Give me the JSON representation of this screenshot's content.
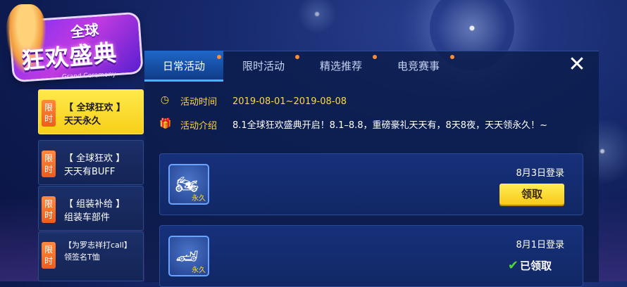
{
  "logo": {
    "line1": "全球",
    "line2": "狂欢盛典",
    "subtitle": "Grand Ceremony"
  },
  "sidebar": {
    "items": [
      {
        "badge": [
          "限",
          "时"
        ],
        "line1": "【 全球狂欢 】",
        "line2": "天天永久",
        "active": true
      },
      {
        "badge": [
          "限",
          "时"
        ],
        "line1": "【 全球狂欢 】",
        "line2": "天天有BUFF",
        "active": false
      },
      {
        "badge": [
          "限",
          "时"
        ],
        "line1": "【 组装补给 】",
        "line2": "组装车部件",
        "active": false
      },
      {
        "badge": [
          "限",
          "时"
        ],
        "line1": "【为罗志祥打call】",
        "line2": "领签名T恤",
        "active": false
      }
    ]
  },
  "tabs": [
    {
      "label": "日常活动",
      "active": true
    },
    {
      "label": "限时活动",
      "active": false
    },
    {
      "label": "精选推荐",
      "active": false
    },
    {
      "label": "电竞赛事",
      "active": false
    }
  ],
  "close_icon": "close-icon",
  "activity": {
    "time_label": "活动时间",
    "time_value": "2019-08-01~2019-08-08",
    "intro_label": "活动介绍",
    "intro_value": "8.1全球狂欢盛典开启！8.1–8.8，重磅豪礼天天有，8天8夜，天天领永久！~"
  },
  "rewards": [
    {
      "icon": "motorcycle-icon",
      "tag": "永久",
      "login_text": "8月3日登录",
      "action_label": "领取",
      "claimed": false
    },
    {
      "icon": "kart-icon",
      "tag": "永久",
      "login_text": "8月1日登录",
      "action_label": "已领取",
      "claimed": true
    }
  ],
  "colors": {
    "accent_yellow": "#ffd93a",
    "badge_orange": "#ef5c1d",
    "tab_active": "#1f67c9",
    "panel_bg": "#0b1c4a"
  }
}
